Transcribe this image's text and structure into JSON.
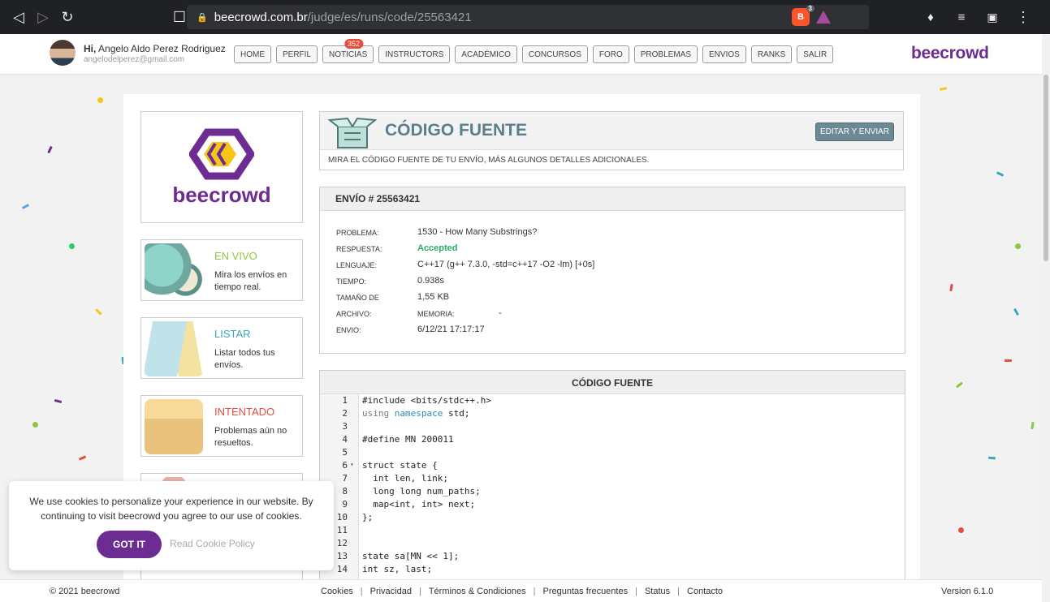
{
  "browser": {
    "url_domain": "beecrowd.com.br",
    "url_path": "/judge/es/runs/code/25563421",
    "brave_badge": "3"
  },
  "header": {
    "greeting_prefix": "Hi,",
    "user_name": "Angelo Aldo Perez Rodriguez",
    "email": "angelodelperez@gmail.com",
    "menu": [
      {
        "label": "HOME"
      },
      {
        "label": "PERFIL"
      },
      {
        "label": "NOTICIAS",
        "badge": "352"
      },
      {
        "label": "INSTRUCTORS"
      },
      {
        "label": "ACADÉMICO"
      },
      {
        "label": "CONCURSOS"
      },
      {
        "label": "FORO"
      },
      {
        "label": "PROBLEMAS"
      },
      {
        "label": "ENVIOS"
      },
      {
        "label": "RANKS"
      },
      {
        "label": "SALIR"
      }
    ],
    "brand": "beecrowd"
  },
  "sidebar": {
    "logo_text": "beecrowd",
    "cards": [
      {
        "title": "EN VIVO",
        "desc": "Mira los envíos en tiempo real.",
        "color": "#8dc63f"
      },
      {
        "title": "LISTAR",
        "desc": "Listar todos tus envíos.",
        "color": "#3aa6b9"
      },
      {
        "title": "INTENTADO",
        "desc": "Problemas aún no resueltos.",
        "color": "#e74c3c"
      }
    ]
  },
  "source_header": {
    "title": "CÓDIGO FUENTE",
    "edit_button": "EDITAR Y ENVIAR",
    "subtitle": "MIRA EL CÓDIGO FUENTE DE TU ENVÍO, MÁS ALGUNOS DETALLES ADICIONALES."
  },
  "submission": {
    "heading": "ENVÍO # 25563421",
    "rows": [
      {
        "key": "PROBLEMA:",
        "value": "1530 - How Many Substrings?"
      },
      {
        "key": "RESPUESTA:",
        "value": "Accepted"
      },
      {
        "key": "LENGUAJE:",
        "value": "C++17 (g++ 7.3.0, -std=c++17 -O2 -lm) [+0s]"
      },
      {
        "key": "TIEMPO:",
        "value": "0.938s"
      },
      {
        "key": "TAMAÑO DE",
        "value": "1,55 KB"
      },
      {
        "key": "ARCHIVO:",
        "value": "MEMORIA:",
        "extra": "-"
      },
      {
        "key": "ENVIO:",
        "value": "6/12/21 17:17:17"
      }
    ]
  },
  "code": {
    "heading": "CÓDIGO FUENTE",
    "lines": [
      {
        "n": "1",
        "t": "#include <bits/stdc++.h>"
      },
      {
        "n": "2",
        "t": "using namespace std;"
      },
      {
        "n": "3",
        "t": ""
      },
      {
        "n": "4",
        "t": "#define MN 200011"
      },
      {
        "n": "5",
        "t": ""
      },
      {
        "n": "6",
        "t": "struct state {"
      },
      {
        "n": "7",
        "t": "  int len, link;"
      },
      {
        "n": "8",
        "t": "  long long num_paths;"
      },
      {
        "n": "9",
        "t": "  map<int, int> next;"
      },
      {
        "n": "10",
        "t": "};"
      },
      {
        "n": "11",
        "t": ""
      },
      {
        "n": "12",
        "t": ""
      },
      {
        "n": "13",
        "t": "state sa[MN << 1];"
      },
      {
        "n": "14",
        "t": "int sz, last;"
      }
    ]
  },
  "cookie": {
    "message": "We use cookies to personalize your experience in our website. By continuing to visit beecrowd you agree to our use of cookies.",
    "accept": "GOT IT",
    "policy": "Read Cookie Policy"
  },
  "footer": {
    "copyright": "© 2021 beecrowd",
    "links": [
      "Cookies",
      "Privacidad",
      "Términos & Condiciones",
      "Preguntas frecuentes",
      "Status",
      "Contacto"
    ],
    "version": "Version 6.1.0"
  },
  "colors": {
    "brand": "#6d2c91",
    "accepted": "#27ae60",
    "title": "#5a7f8a"
  }
}
